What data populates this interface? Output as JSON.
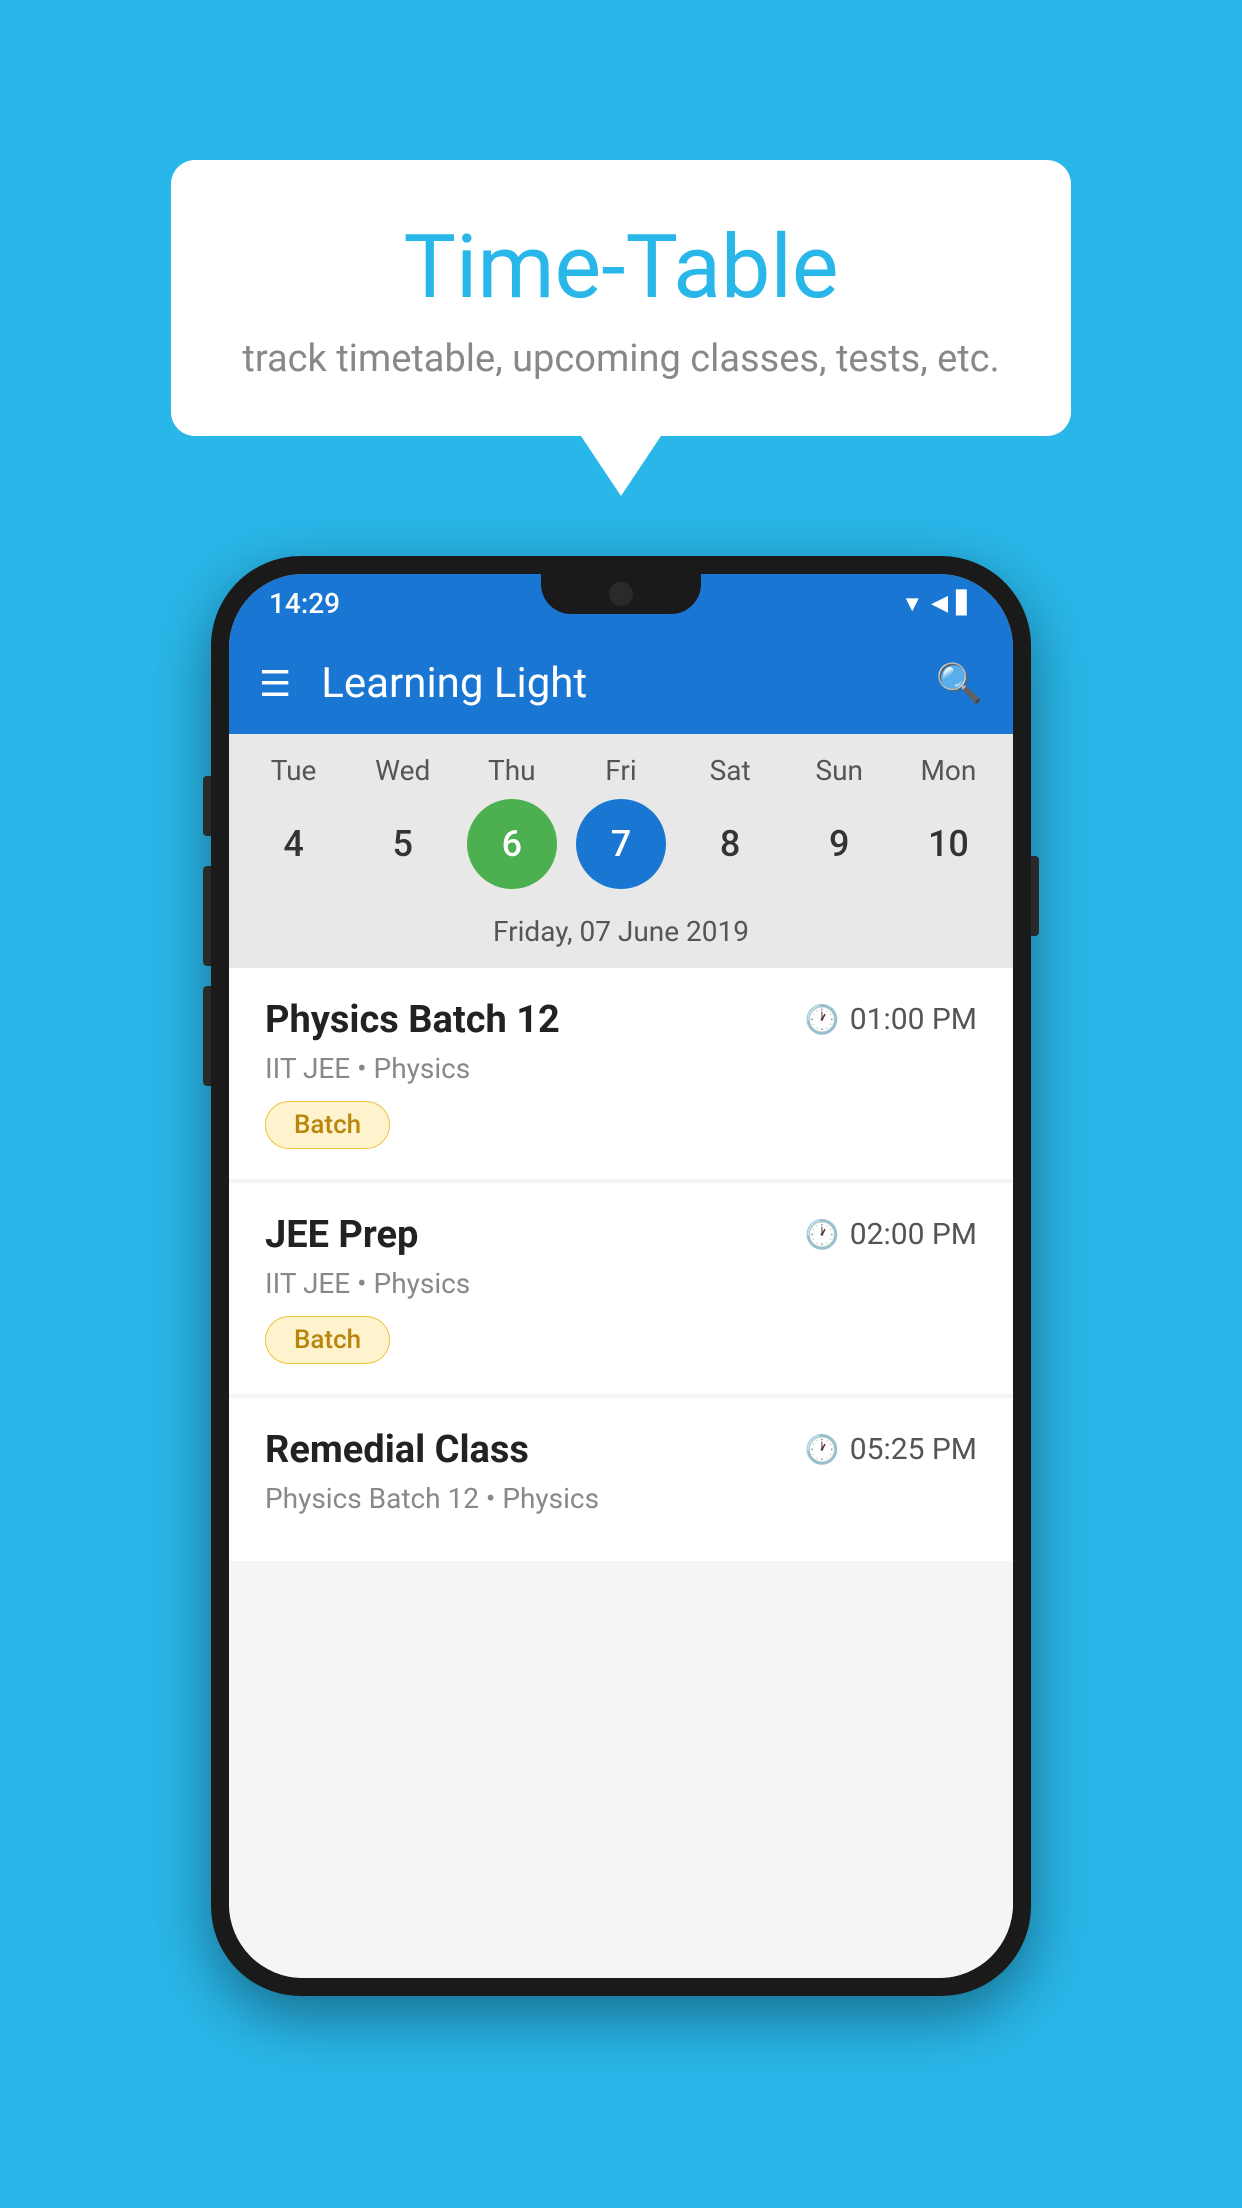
{
  "background": {
    "color": "#29B6E8"
  },
  "speech_bubble": {
    "title": "Time-Table",
    "subtitle": "track timetable, upcoming classes, tests, etc."
  },
  "phone": {
    "status_bar": {
      "time": "14:29"
    },
    "app_bar": {
      "title": "Learning Light"
    },
    "calendar": {
      "days": [
        {
          "label": "Tue",
          "number": "4",
          "state": "normal"
        },
        {
          "label": "Wed",
          "number": "5",
          "state": "normal"
        },
        {
          "label": "Thu",
          "number": "6",
          "state": "today"
        },
        {
          "label": "Fri",
          "number": "7",
          "state": "selected"
        },
        {
          "label": "Sat",
          "number": "8",
          "state": "normal"
        },
        {
          "label": "Sun",
          "number": "9",
          "state": "normal"
        },
        {
          "label": "Mon",
          "number": "10",
          "state": "normal"
        }
      ],
      "selected_date_label": "Friday, 07 June 2019"
    },
    "schedule": [
      {
        "title": "Physics Batch 12",
        "time": "01:00 PM",
        "subtitle": "IIT JEE • Physics",
        "tag": "Batch"
      },
      {
        "title": "JEE Prep",
        "time": "02:00 PM",
        "subtitle": "IIT JEE • Physics",
        "tag": "Batch"
      },
      {
        "title": "Remedial Class",
        "time": "05:25 PM",
        "subtitle": "Physics Batch 12 • Physics",
        "tag": null
      }
    ]
  }
}
